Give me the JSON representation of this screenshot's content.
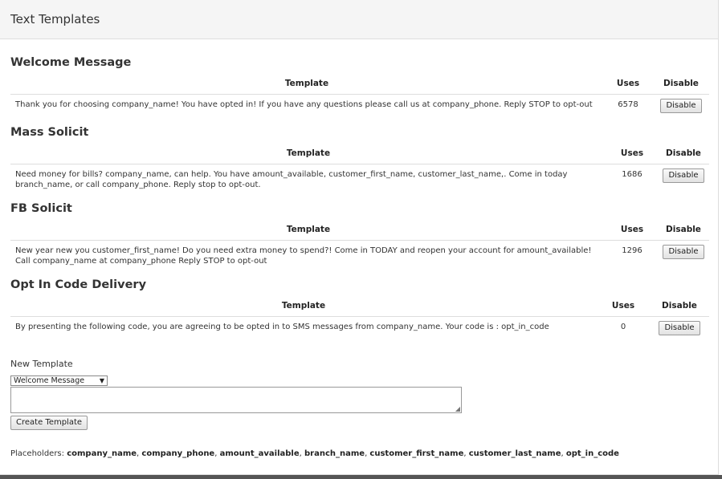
{
  "panel": {
    "title": "Text Templates"
  },
  "columns": {
    "template": "Template",
    "uses": "Uses",
    "disable": "Disable"
  },
  "sections": [
    {
      "title": "Welcome Message",
      "text": "Thank you for choosing company_name! You have opted in! If you have any questions please call us at company_phone. Reply STOP to opt-out",
      "uses": "6578",
      "button": "Disable"
    },
    {
      "title": "Mass Solicit",
      "text": "Need money for bills? company_name, can help. You have amount_available, customer_first_name, customer_last_name,. Come in today branch_name, or call company_phone. Reply stop to opt-out.",
      "uses": "1686",
      "button": "Disable"
    },
    {
      "title": "FB Solicit",
      "text": "New year new you customer_first_name! Do you need extra money to spend?! Come in TODAY and reopen your account for amount_available! Call company_name at company_phone Reply STOP to opt-out",
      "uses": "1296",
      "button": "Disable"
    },
    {
      "title": "Opt In Code Delivery",
      "text": "By presenting the following code, you are agreeing to be opted in to SMS messages from company_name. Your code is : opt_in_code",
      "uses": "0",
      "button": "Disable"
    }
  ],
  "new_template": {
    "label": "New Template",
    "selected": "Welcome Message",
    "textarea_value": "",
    "create_label": "Create Template"
  },
  "placeholders": {
    "label": "Placeholders:",
    "items": [
      "company_name",
      "company_phone",
      "amount_available",
      "branch_name",
      "customer_first_name",
      "customer_last_name",
      "opt_in_code"
    ]
  }
}
